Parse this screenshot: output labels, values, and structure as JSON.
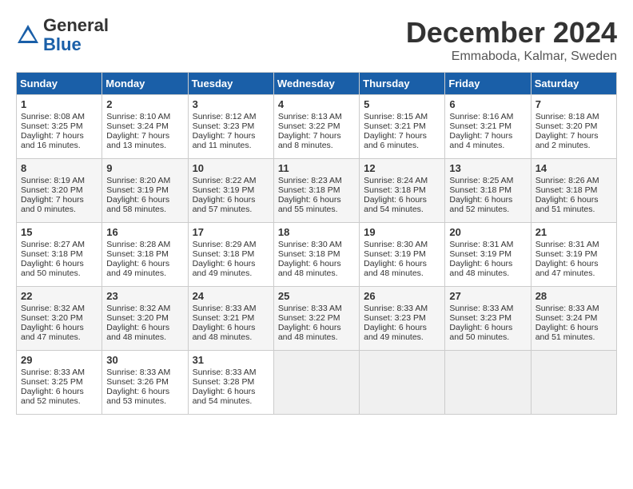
{
  "header": {
    "logo_general": "General",
    "logo_blue": "Blue",
    "month_title": "December 2024",
    "location": "Emmaboda, Kalmar, Sweden"
  },
  "days_of_week": [
    "Sunday",
    "Monday",
    "Tuesday",
    "Wednesday",
    "Thursday",
    "Friday",
    "Saturday"
  ],
  "weeks": [
    [
      {
        "day": "1",
        "info": "Sunrise: 8:08 AM\nSunset: 3:25 PM\nDaylight: 7 hours and 16 minutes."
      },
      {
        "day": "2",
        "info": "Sunrise: 8:10 AM\nSunset: 3:24 PM\nDaylight: 7 hours and 13 minutes."
      },
      {
        "day": "3",
        "info": "Sunrise: 8:12 AM\nSunset: 3:23 PM\nDaylight: 7 hours and 11 minutes."
      },
      {
        "day": "4",
        "info": "Sunrise: 8:13 AM\nSunset: 3:22 PM\nDaylight: 7 hours and 8 minutes."
      },
      {
        "day": "5",
        "info": "Sunrise: 8:15 AM\nSunset: 3:21 PM\nDaylight: 7 hours and 6 minutes."
      },
      {
        "day": "6",
        "info": "Sunrise: 8:16 AM\nSunset: 3:21 PM\nDaylight: 7 hours and 4 minutes."
      },
      {
        "day": "7",
        "info": "Sunrise: 8:18 AM\nSunset: 3:20 PM\nDaylight: 7 hours and 2 minutes."
      }
    ],
    [
      {
        "day": "8",
        "info": "Sunrise: 8:19 AM\nSunset: 3:20 PM\nDaylight: 7 hours and 0 minutes."
      },
      {
        "day": "9",
        "info": "Sunrise: 8:20 AM\nSunset: 3:19 PM\nDaylight: 6 hours and 58 minutes."
      },
      {
        "day": "10",
        "info": "Sunrise: 8:22 AM\nSunset: 3:19 PM\nDaylight: 6 hours and 57 minutes."
      },
      {
        "day": "11",
        "info": "Sunrise: 8:23 AM\nSunset: 3:18 PM\nDaylight: 6 hours and 55 minutes."
      },
      {
        "day": "12",
        "info": "Sunrise: 8:24 AM\nSunset: 3:18 PM\nDaylight: 6 hours and 54 minutes."
      },
      {
        "day": "13",
        "info": "Sunrise: 8:25 AM\nSunset: 3:18 PM\nDaylight: 6 hours and 52 minutes."
      },
      {
        "day": "14",
        "info": "Sunrise: 8:26 AM\nSunset: 3:18 PM\nDaylight: 6 hours and 51 minutes."
      }
    ],
    [
      {
        "day": "15",
        "info": "Sunrise: 8:27 AM\nSunset: 3:18 PM\nDaylight: 6 hours and 50 minutes."
      },
      {
        "day": "16",
        "info": "Sunrise: 8:28 AM\nSunset: 3:18 PM\nDaylight: 6 hours and 49 minutes."
      },
      {
        "day": "17",
        "info": "Sunrise: 8:29 AM\nSunset: 3:18 PM\nDaylight: 6 hours and 49 minutes."
      },
      {
        "day": "18",
        "info": "Sunrise: 8:30 AM\nSunset: 3:18 PM\nDaylight: 6 hours and 48 minutes."
      },
      {
        "day": "19",
        "info": "Sunrise: 8:30 AM\nSunset: 3:19 PM\nDaylight: 6 hours and 48 minutes."
      },
      {
        "day": "20",
        "info": "Sunrise: 8:31 AM\nSunset: 3:19 PM\nDaylight: 6 hours and 48 minutes."
      },
      {
        "day": "21",
        "info": "Sunrise: 8:31 AM\nSunset: 3:19 PM\nDaylight: 6 hours and 47 minutes."
      }
    ],
    [
      {
        "day": "22",
        "info": "Sunrise: 8:32 AM\nSunset: 3:20 PM\nDaylight: 6 hours and 47 minutes."
      },
      {
        "day": "23",
        "info": "Sunrise: 8:32 AM\nSunset: 3:20 PM\nDaylight: 6 hours and 48 minutes."
      },
      {
        "day": "24",
        "info": "Sunrise: 8:33 AM\nSunset: 3:21 PM\nDaylight: 6 hours and 48 minutes."
      },
      {
        "day": "25",
        "info": "Sunrise: 8:33 AM\nSunset: 3:22 PM\nDaylight: 6 hours and 48 minutes."
      },
      {
        "day": "26",
        "info": "Sunrise: 8:33 AM\nSunset: 3:23 PM\nDaylight: 6 hours and 49 minutes."
      },
      {
        "day": "27",
        "info": "Sunrise: 8:33 AM\nSunset: 3:23 PM\nDaylight: 6 hours and 50 minutes."
      },
      {
        "day": "28",
        "info": "Sunrise: 8:33 AM\nSunset: 3:24 PM\nDaylight: 6 hours and 51 minutes."
      }
    ],
    [
      {
        "day": "29",
        "info": "Sunrise: 8:33 AM\nSunset: 3:25 PM\nDaylight: 6 hours and 52 minutes."
      },
      {
        "day": "30",
        "info": "Sunrise: 8:33 AM\nSunset: 3:26 PM\nDaylight: 6 hours and 53 minutes."
      },
      {
        "day": "31",
        "info": "Sunrise: 8:33 AM\nSunset: 3:28 PM\nDaylight: 6 hours and 54 minutes."
      },
      {
        "day": "",
        "info": ""
      },
      {
        "day": "",
        "info": ""
      },
      {
        "day": "",
        "info": ""
      },
      {
        "day": "",
        "info": ""
      }
    ]
  ]
}
